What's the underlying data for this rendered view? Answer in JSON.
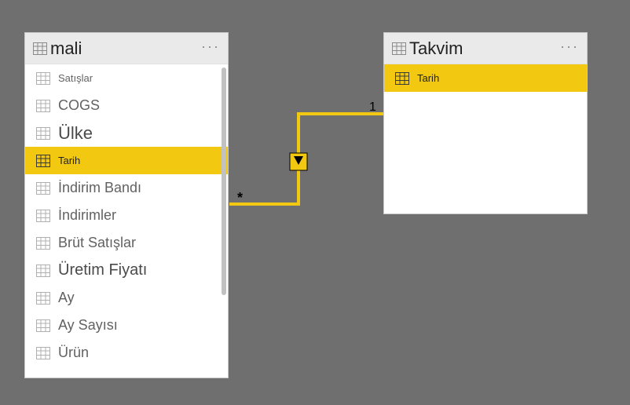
{
  "tables": {
    "mali": {
      "title": "mali",
      "fields": [
        {
          "label": "Satışlar",
          "selected": false,
          "size": "sm"
        },
        {
          "label": "COGS",
          "selected": false,
          "size": "md"
        },
        {
          "label": "Ülke",
          "selected": false,
          "size": "lg"
        },
        {
          "label": "Tarih",
          "selected": true,
          "size": "sm"
        },
        {
          "label": "İndirim Bandı",
          "selected": false,
          "size": "md"
        },
        {
          "label": "İndirimler",
          "selected": false,
          "size": "md"
        },
        {
          "label": "Brüt Satışlar",
          "selected": false,
          "size": "md"
        },
        {
          "label": "Üretim Fiyatı",
          "selected": false,
          "size": "ml"
        },
        {
          "label": "Ay",
          "selected": false,
          "size": "md"
        },
        {
          "label": "Ay Sayısı",
          "selected": false,
          "size": "md"
        },
        {
          "label": "Ürün",
          "selected": false,
          "size": "md"
        }
      ]
    },
    "takvim": {
      "title": "Takvim",
      "fields": [
        {
          "label": "Tarih",
          "selected": true,
          "size": "sm"
        }
      ]
    }
  },
  "relationship": {
    "many_label": "*",
    "one_label": "1"
  }
}
